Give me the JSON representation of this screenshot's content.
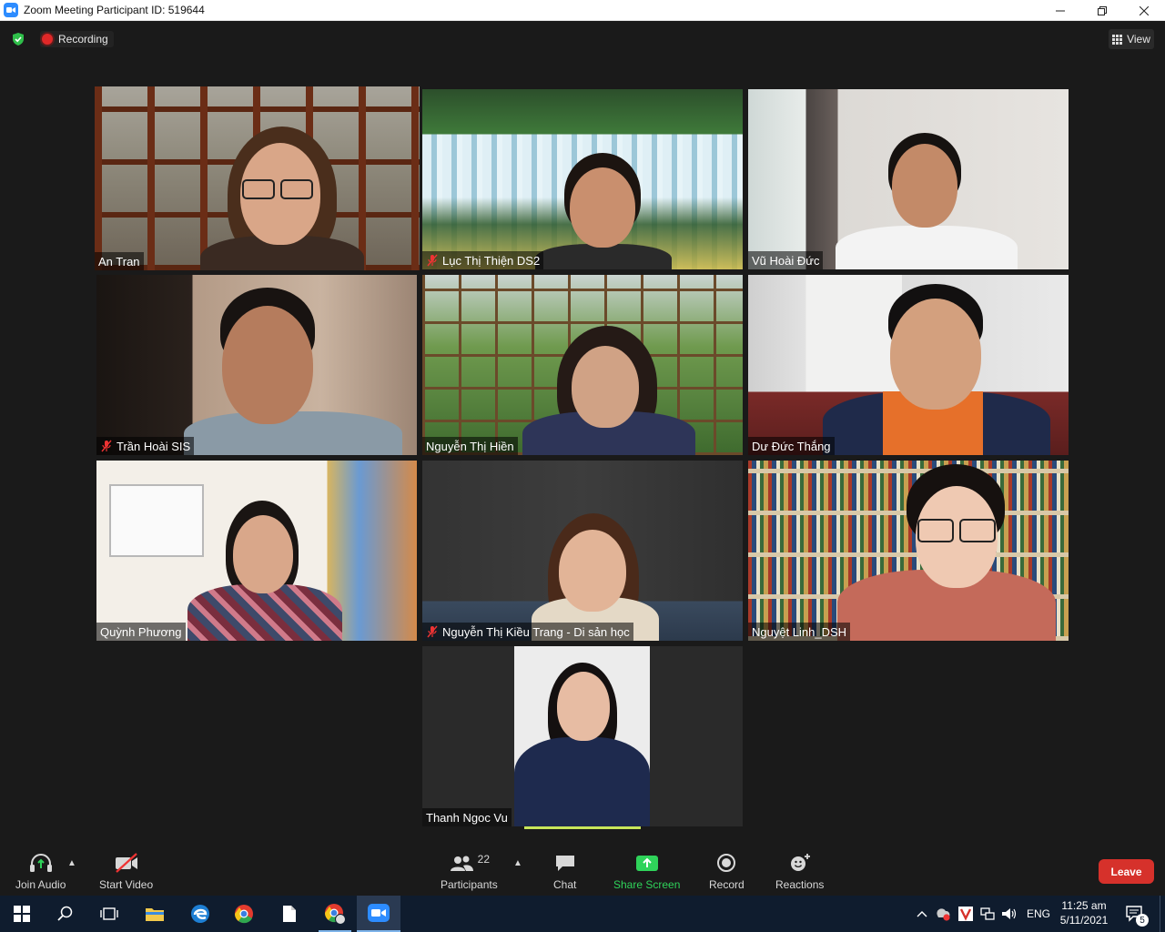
{
  "window": {
    "title": "Zoom Meeting Participant ID: 519644",
    "controls": [
      "minimize-icon",
      "restore-icon",
      "close-icon"
    ]
  },
  "topbar": {
    "recording_label": "Recording",
    "view_label": "View"
  },
  "participants": [
    {
      "name": "An Tran",
      "muted": false,
      "active_speaker": true
    },
    {
      "name": "Lục Thị Thiện DS2",
      "muted": true,
      "active_speaker": false
    },
    {
      "name": "Vũ Hoài Đức",
      "muted": false,
      "active_speaker": false
    },
    {
      "name": "Trần Hoài SIS",
      "muted": true,
      "active_speaker": false
    },
    {
      "name": "Nguyễn Thị Hiền",
      "muted": false,
      "active_speaker": false
    },
    {
      "name": "Dư Đức Thắng",
      "muted": false,
      "active_speaker": false
    },
    {
      "name": "Quỳnh Phương",
      "muted": false,
      "active_speaker": false
    },
    {
      "name": "Nguyễn Thị Kiều Trang - Di sản học",
      "muted": true,
      "active_speaker": false
    },
    {
      "name": "Nguyệt Linh_DSH",
      "muted": false,
      "active_speaker": false
    },
    {
      "name": "Thanh Ngoc Vu",
      "muted": false,
      "active_speaker": false
    }
  ],
  "toolbar": {
    "join_audio": "Join Audio",
    "start_video": "Start Video",
    "participants": "Participants",
    "participants_count": "22",
    "chat": "Chat",
    "share_screen": "Share Screen",
    "record": "Record",
    "reactions": "Reactions",
    "leave": "Leave"
  },
  "taskbar": {
    "apps": [
      "windows-start-icon",
      "search-icon",
      "task-view-icon",
      "file-explorer-icon",
      "edge-icon",
      "chrome-icon",
      "document-icon",
      "chrome-profile-icon",
      "zoom-icon"
    ],
    "language": "ENG",
    "time": "11:25 am",
    "date": "5/11/2021",
    "notification_count": "5"
  },
  "colors": {
    "active_speaker_border": "#c8e65a",
    "share_screen_green": "#2fd35a",
    "leave_red": "#d6312b",
    "background": "#1a1a1a"
  }
}
